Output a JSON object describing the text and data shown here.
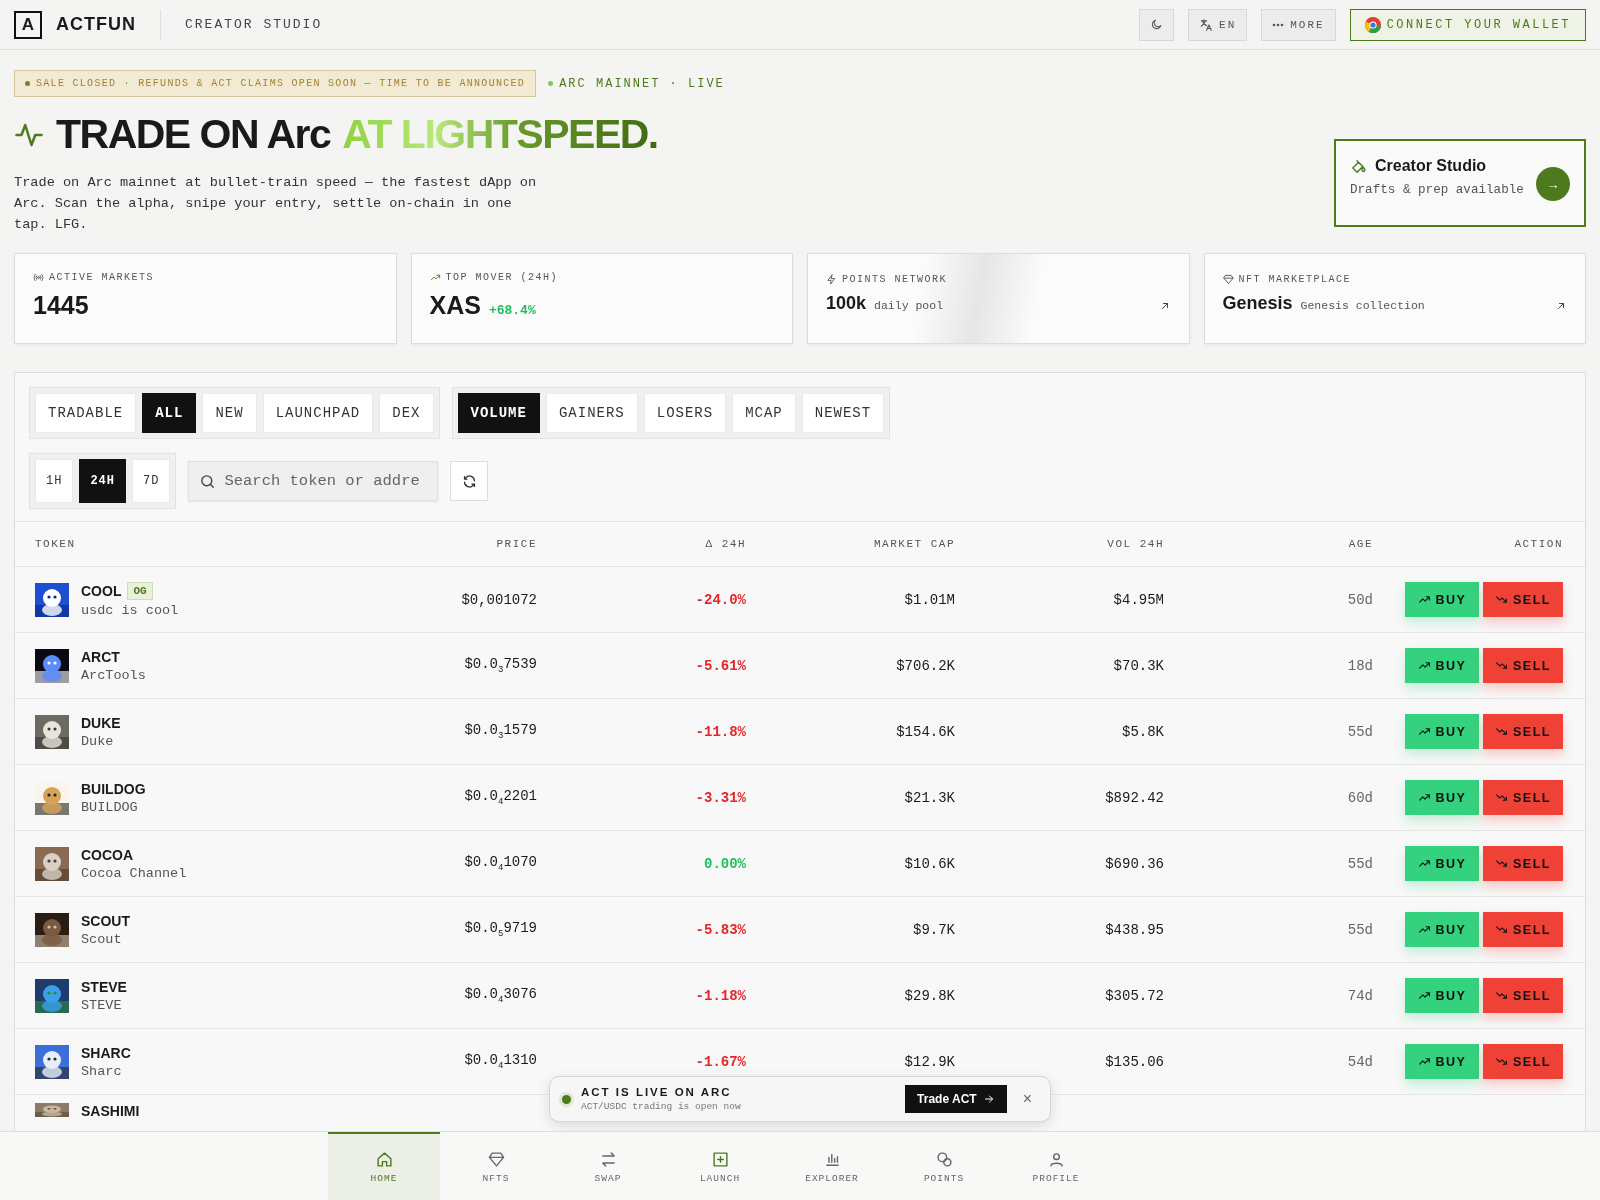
{
  "header": {
    "logo_letter": "A",
    "brand": "ACTFUN",
    "section": "CREATOR STUDIO",
    "language": "EN",
    "more": "MORE",
    "wallet": "CONNECT YOUR WALLET"
  },
  "notice": "SALE CLOSED · REFUNDS & ACT CLAIMS OPEN SOON — TIME TO BE ANNOUNCED",
  "network": "ARC MAINNET · LIVE",
  "hero": {
    "title": "TRADE ON Arc",
    "accent": "AT LIGHTSPEED.",
    "description": "Trade on Arc mainnet at bullet-train speed — the fastest dApp on Arc. Scan the alpha, snipe your entry, settle on-chain in one tap. LFG."
  },
  "creator_card": {
    "title": "Creator Studio",
    "subtitle": "Drafts & prep available",
    "arrow": "→"
  },
  "stats": [
    {
      "kind": "plain",
      "label": "ACTIVE MARKETS",
      "value": "1445"
    },
    {
      "kind": "change",
      "label": "TOP MOVER (24H)",
      "value": "XAS",
      "change": "+68.4%"
    },
    {
      "kind": "link",
      "label": "POINTS NETWORK",
      "value": "100k",
      "note": "daily pool"
    },
    {
      "kind": "link",
      "label": "NFT MARKETPLACE",
      "value": "Genesis",
      "note": "Genesis collection"
    }
  ],
  "filters": {
    "categories": [
      {
        "label": "TRADABLE",
        "selected": false
      },
      {
        "label": "ALL",
        "selected": true
      },
      {
        "label": "NEW",
        "selected": false
      },
      {
        "label": "LAUNCHPAD",
        "selected": false
      },
      {
        "label": "DEX",
        "selected": false
      }
    ],
    "sorts": [
      {
        "label": "VOLUME",
        "selected": true
      },
      {
        "label": "GAINERS",
        "selected": false
      },
      {
        "label": "LOSERS",
        "selected": false
      },
      {
        "label": "MCAP",
        "selected": false
      },
      {
        "label": "NEWEST",
        "selected": false
      }
    ],
    "periods": [
      {
        "label": "1H",
        "selected": false
      },
      {
        "label": "24H",
        "selected": true
      },
      {
        "label": "7D",
        "selected": false
      }
    ],
    "search": {
      "placeholder": "Search token or addre"
    }
  },
  "table": {
    "columns": [
      "TOKEN",
      "PRICE",
      "Δ 24H",
      "MARKET CAP",
      "VOL 24H",
      "AGE",
      "ACTION"
    ],
    "rows": [
      {
        "symbol": "COOL",
        "badge": "OG",
        "name": "usdc is cool",
        "price": {
          "lead": "$0,001072"
        },
        "change": "-24.0%",
        "color": "#e3262b",
        "market_cap": "$1.01M",
        "volume": "$4.95M",
        "age": "50d",
        "buy": "BUY",
        "sell": "SELL"
      },
      {
        "symbol": "ARCT",
        "name": "ArcTools",
        "price": {
          "lead": "$0.0",
          "sub": "3",
          "tail": "7539"
        },
        "change": "-5.61%",
        "color": "#e3262b",
        "market_cap": "$706.2K",
        "volume": "$70.3K",
        "age": "18d",
        "buy": "BUY",
        "sell": "SELL"
      },
      {
        "symbol": "DUKE",
        "name": "Duke",
        "price": {
          "lead": "$0.0",
          "sub": "3",
          "tail": "1579"
        },
        "change": "-11.8%",
        "color": "#e3262b",
        "market_cap": "$154.6K",
        "volume": "$5.8K",
        "age": "55d",
        "buy": "BUY",
        "sell": "SELL"
      },
      {
        "symbol": "BUILDOG",
        "name": "BUILDOG",
        "price": {
          "lead": "$0.0",
          "sub": "4",
          "tail": "2201"
        },
        "change": "-3.31%",
        "color": "#e3262b",
        "market_cap": "$21.3K",
        "volume": "$892.42",
        "age": "60d",
        "buy": "BUY",
        "sell": "SELL"
      },
      {
        "symbol": "COCOA",
        "name": "Cocoa Channel",
        "price": {
          "lead": "$0.0",
          "sub": "4",
          "tail": "1070"
        },
        "change": "0.00%",
        "color": "#1fbf5b",
        "market_cap": "$10.6K",
        "volume": "$690.36",
        "age": "55d",
        "buy": "BUY",
        "sell": "SELL"
      },
      {
        "symbol": "SCOUT",
        "name": "Scout",
        "price": {
          "lead": "$0.0",
          "sub": "5",
          "tail": "9719"
        },
        "change": "-5.83%",
        "color": "#e3262b",
        "market_cap": "$9.7K",
        "volume": "$438.95",
        "age": "55d",
        "buy": "BUY",
        "sell": "SELL"
      },
      {
        "symbol": "STEVE",
        "name": "STEVE",
        "price": {
          "lead": "$0.0",
          "sub": "4",
          "tail": "3076"
        },
        "change": "-1.18%",
        "color": "#e3262b",
        "market_cap": "$29.8K",
        "volume": "$305.72",
        "age": "74d",
        "buy": "BUY",
        "sell": "SELL"
      },
      {
        "symbol": "SHARC",
        "name": "Sharc",
        "price": {
          "lead": "$0.0",
          "sub": "4",
          "tail": "1310"
        },
        "change": "-1.67%",
        "color": "#e3262b",
        "market_cap": "$12.9K",
        "volume": "$135.06",
        "age": "54d",
        "buy": "BUY",
        "sell": "SELL"
      },
      {
        "symbol": "SASHIMI"
      }
    ]
  },
  "toast": {
    "title": "ACT IS LIVE ON ARC",
    "subtitle": "ACT/USDC trading is open now",
    "action": "Trade ACT",
    "close": "×"
  },
  "nav": [
    {
      "label": "HOME",
      "selected": true
    },
    {
      "label": "NFTS",
      "selected": false
    },
    {
      "label": "SWAP",
      "selected": false
    },
    {
      "label": "LAUNCH",
      "selected": false
    },
    {
      "label": "EXPLORER",
      "selected": false
    },
    {
      "label": "POINTS",
      "selected": false
    },
    {
      "label": "PROFILE",
      "selected": false
    }
  ]
}
